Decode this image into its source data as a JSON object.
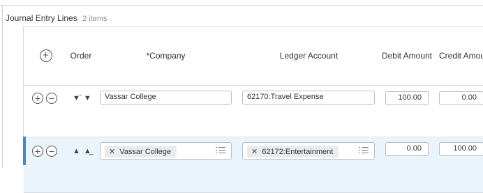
{
  "section": {
    "title": "Journal Entry Lines",
    "count": "2 items"
  },
  "columns": {
    "order": "Order",
    "company": "*Company",
    "ledger": "Ledger Account",
    "debit": "Debit Amount",
    "credit": "Credit Amount"
  },
  "rows": [
    {
      "company": "Vassar College",
      "ledger": "62170:Travel Expense",
      "debit": "100.00",
      "credit": "0.00"
    },
    {
      "company": "Vassar College",
      "ledger": "62172:Entertainment",
      "debit": "0.00",
      "credit": "100.00"
    }
  ],
  "icons": {
    "add": "+",
    "remove": "−",
    "move_down": "▼",
    "move_bottom": "▼̄",
    "move_up": "▲",
    "move_top": "▲̲",
    "clear": "✕"
  },
  "colors": {
    "selected_row_bg": "#eaf4fb",
    "selected_accent": "#3b8ad9"
  }
}
